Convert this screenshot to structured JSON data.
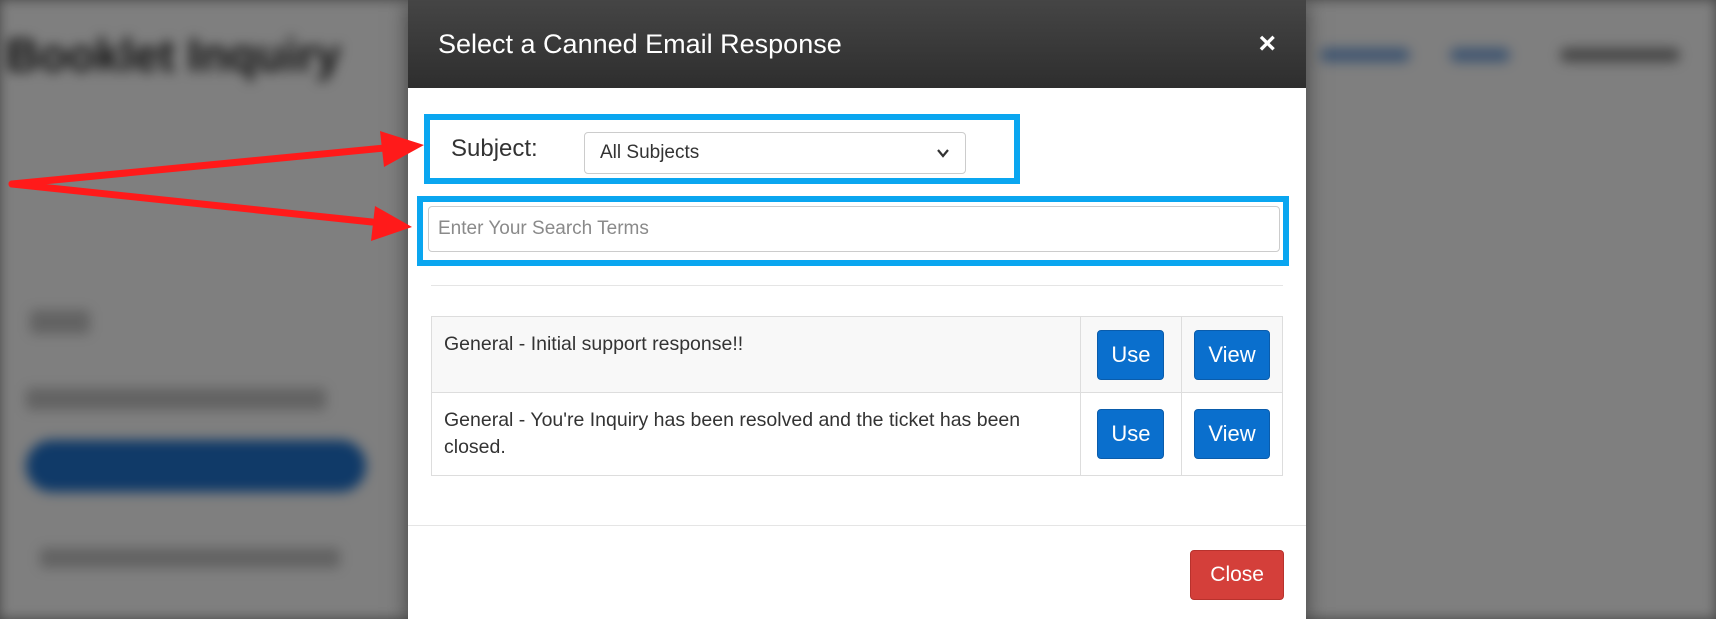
{
  "background": {
    "page_title": "Booklet Inquiry"
  },
  "modal": {
    "title": "Select a Canned Email Response",
    "close_icon": "close-icon",
    "subject_label": "Subject:",
    "subject_selected": "All Subjects",
    "search_placeholder": "Enter Your Search Terms",
    "responses": [
      {
        "text": "General - Initial support response!!",
        "use_label": "Use",
        "view_label": "View"
      },
      {
        "text": "General - You're Inquiry has been resolved and the ticket has been closed.",
        "use_label": "Use",
        "view_label": "View"
      }
    ],
    "close_button": "Close"
  },
  "annotation": {
    "highlight_color": "#0aa6f0",
    "arrow_color": "#ff1a1a"
  },
  "colors": {
    "header_bg": "#3a3a3a",
    "primary_button": "#0a6fcd",
    "danger_button": "#d43f3a"
  }
}
